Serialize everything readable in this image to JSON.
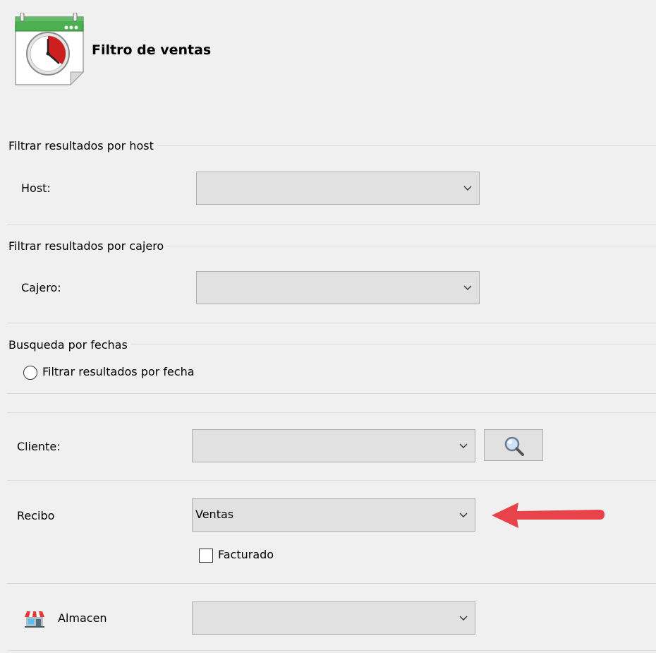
{
  "header": {
    "title": "Filtro de ventas",
    "icon": "calendar-clock-icon"
  },
  "host_group": {
    "legend": "Filtrar resultados por host",
    "label": "Host:",
    "value": ""
  },
  "cajero_group": {
    "legend": "Filtrar resultados por cajero",
    "label": "Cajero:",
    "value": ""
  },
  "fecha_group": {
    "legend": "Busqueda por fechas",
    "radio_label": "Filtrar resultados por fecha"
  },
  "cliente": {
    "label": "Cliente:",
    "value": "",
    "search_icon": "magnifier-icon"
  },
  "recibo": {
    "label": "Recibo",
    "value": "Ventas",
    "checkbox_label": "Facturado",
    "checkbox_checked": false
  },
  "almacen": {
    "label": "Almacen",
    "value": "",
    "icon": "store-icon"
  },
  "annotation": {
    "arrow_color": "#e8424a"
  },
  "colors": {
    "calendar_green": "#4caf50",
    "clock_red": "#cc1f1f"
  }
}
